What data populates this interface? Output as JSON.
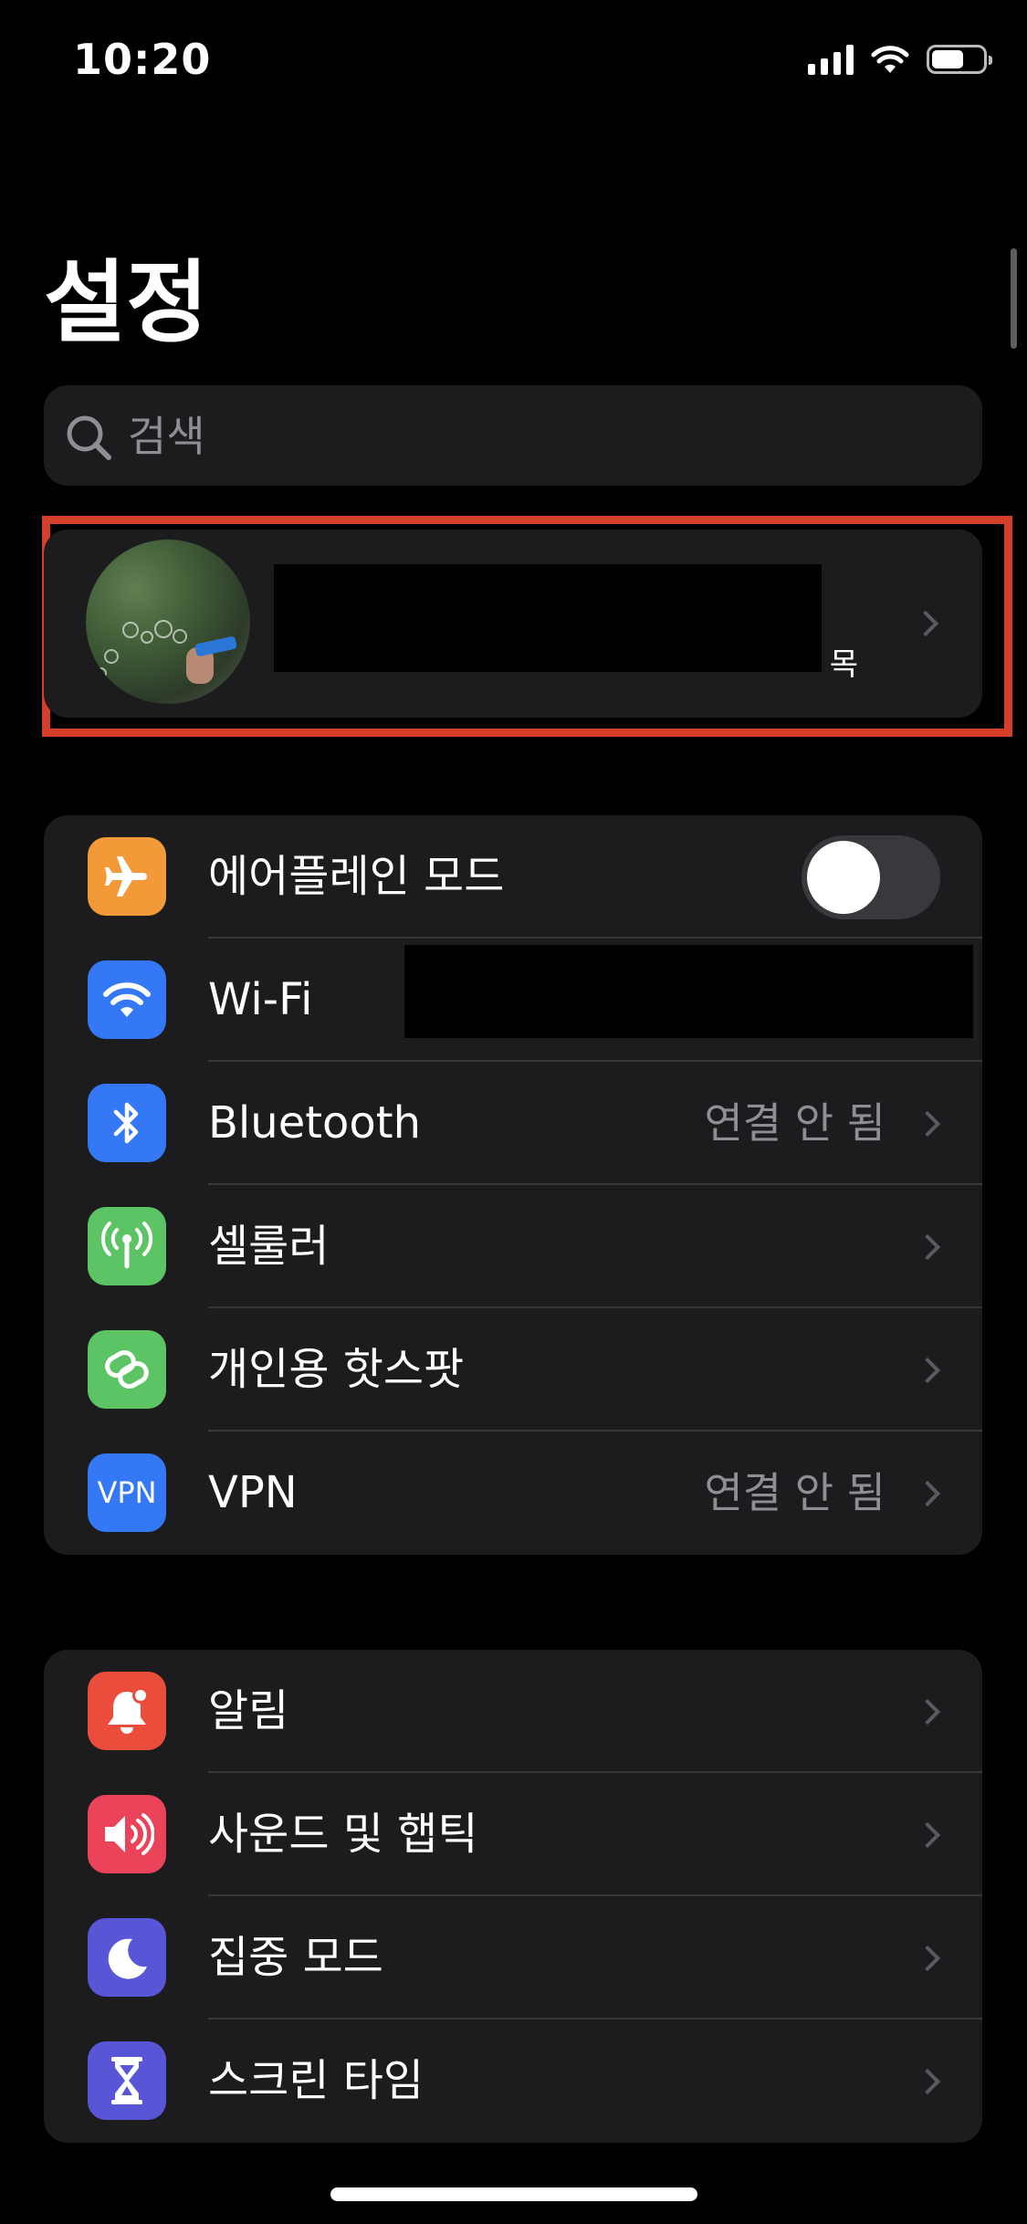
{
  "status_bar": {
    "time": "10:20"
  },
  "title": "설정",
  "search": {
    "placeholder": "검색"
  },
  "profile": {
    "subtitle_visible_fragment": "목"
  },
  "group1": {
    "airplane": {
      "label": "에어플레인 모드",
      "toggle_on": false
    },
    "wifi": {
      "label": "Wi-Fi"
    },
    "bluetooth": {
      "label": "Bluetooth",
      "value": "연결 안 됨"
    },
    "cellular": {
      "label": "셀룰러"
    },
    "hotspot": {
      "label": "개인용 핫스팟"
    },
    "vpn": {
      "label": "VPN",
      "value": "연결 안 됨",
      "icon_text": "VPN"
    }
  },
  "group2": {
    "notifications": {
      "label": "알림"
    },
    "sounds": {
      "label": "사운드 및 햅틱"
    },
    "focus": {
      "label": "집중 모드"
    },
    "screentime": {
      "label": "스크린 타임"
    }
  },
  "colors": {
    "airplane": "#f19a37",
    "wifi": "#3478f6",
    "bluetooth": "#3478f6",
    "cellular": "#5dc466",
    "hotspot": "#5dc466",
    "vpn": "#3478f6",
    "notifications": "#eb4d3d",
    "sounds": "#eb445a",
    "focus": "#5856d6",
    "screentime": "#5856d6",
    "highlight": "#d33f2a"
  },
  "icons": {
    "airplane": "airplane-icon",
    "wifi": "wifi-icon",
    "bluetooth": "bluetooth-icon",
    "cellular": "antenna-icon",
    "hotspot": "chain-link-icon",
    "vpn": "vpn-icon",
    "notifications": "bell-icon",
    "sounds": "speaker-icon",
    "focus": "moon-icon",
    "screentime": "hourglass-icon"
  }
}
